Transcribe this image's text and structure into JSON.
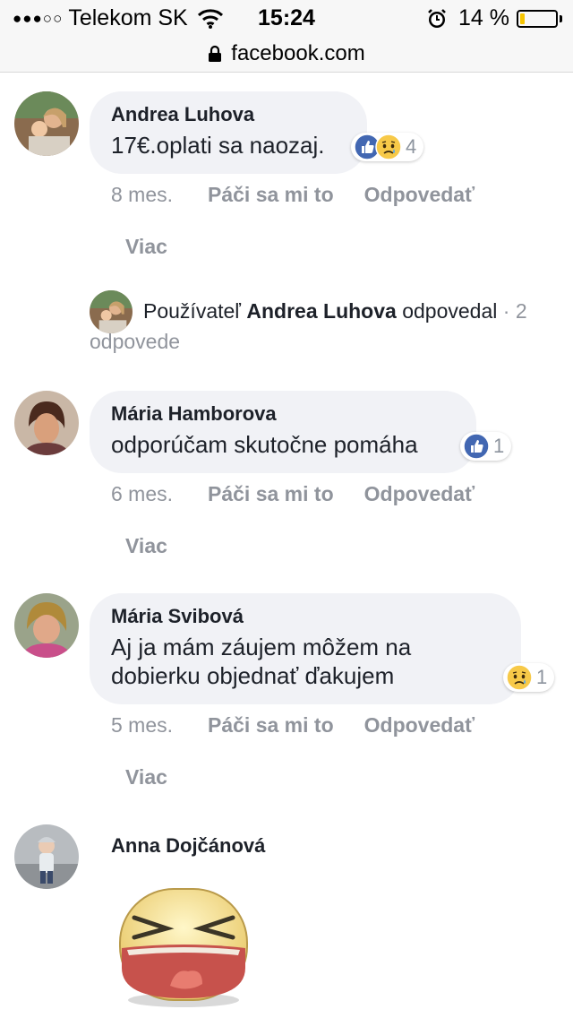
{
  "status_bar": {
    "carrier": "Telekom SK",
    "signal_dots": "●●●○○",
    "time": "15:24",
    "battery_percent": "14 %",
    "battery_level": 0.14
  },
  "url_bar": {
    "domain": "facebook.com"
  },
  "comments": [
    {
      "author": "Andrea Luhova",
      "text": "17€.oplati sa naozaj.",
      "reactions": [
        "like-icon",
        "sad-icon"
      ],
      "reaction_count": "4",
      "time": "8 mes.",
      "like_label": "Páči sa mi to",
      "reply_label": "Odpovedať",
      "more_label": "Viac"
    },
    {
      "author": "Mária Hamborova",
      "text": "odporúčam skutočne pomáha",
      "reactions": [
        "like-icon"
      ],
      "reaction_count": "1",
      "time": "6 mes.",
      "like_label": "Páči sa mi to",
      "reply_label": "Odpovedať",
      "more_label": "Viac"
    },
    {
      "author": "Mária Svibová",
      "text_line1": "Aj ja mám záujem môžem na",
      "text_line2": "dobierku objednať ďakujem",
      "reactions": [
        "sad-icon"
      ],
      "reaction_count": "1",
      "time": "5 mes.",
      "like_label": "Páči sa mi to",
      "reply_label": "Odpovedať",
      "more_label": "Viac"
    },
    {
      "author": "Anna Dojčánová",
      "sticker": "laughing-sticker"
    }
  ],
  "replies_summary": {
    "prefix": "Používateľ ",
    "name": "Andrea Luhova",
    "verb": " odpovedal",
    "separator": " · ",
    "count_text": "2 odpovede"
  },
  "colors": {
    "like_blue": "#4267b2",
    "sad_yellow": "#f7c948",
    "muted_text": "#90949c",
    "bubble_bg": "#f1f2f6"
  }
}
